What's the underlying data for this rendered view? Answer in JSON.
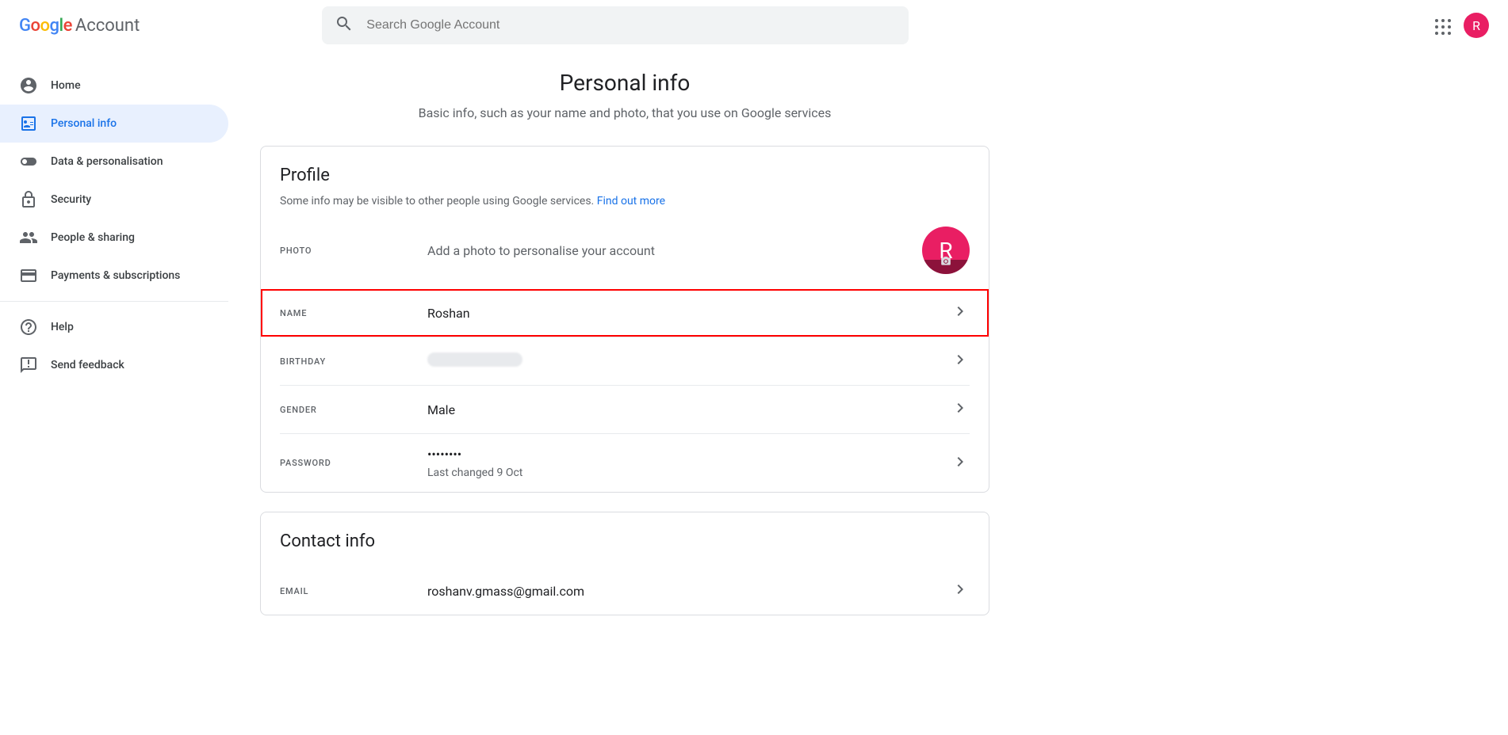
{
  "header": {
    "logo_account": "Account",
    "search_placeholder": "Search Google Account",
    "avatar_letter": "R"
  },
  "sidebar": {
    "items": [
      {
        "label": "Home"
      },
      {
        "label": "Personal info"
      },
      {
        "label": "Data & personalisation"
      },
      {
        "label": "Security"
      },
      {
        "label": "People & sharing"
      },
      {
        "label": "Payments & subscriptions"
      }
    ],
    "help": "Help",
    "feedback": "Send feedback"
  },
  "page": {
    "title": "Personal info",
    "subtitle": "Basic info, such as your name and photo, that you use on Google services"
  },
  "profile": {
    "title": "Profile",
    "subtitle_text": "Some info may be visible to other people using Google services. ",
    "subtitle_link": "Find out more",
    "photo_label": "PHOTO",
    "photo_hint": "Add a photo to personalise your account",
    "photo_letter": "R",
    "name_label": "NAME",
    "name_value": "Roshan",
    "birthday_label": "BIRTHDAY",
    "gender_label": "GENDER",
    "gender_value": "Male",
    "password_label": "PASSWORD",
    "password_value": "••••••••",
    "password_sub": "Last changed 9 Oct"
  },
  "contact": {
    "title": "Contact info",
    "email_label": "EMAIL",
    "email_value": "roshanv.gmass@gmail.com"
  }
}
